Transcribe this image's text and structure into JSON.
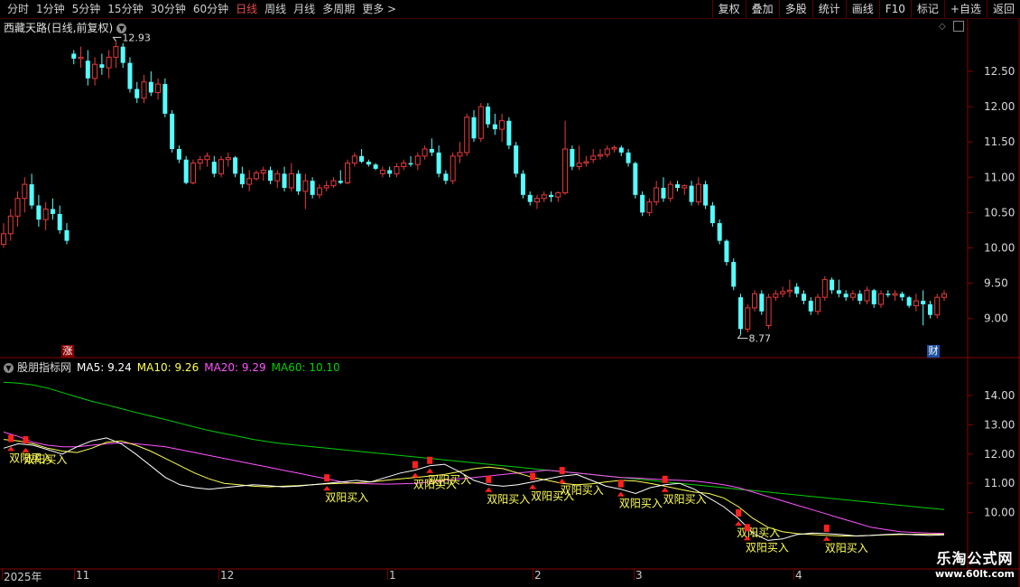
{
  "toolbar": {
    "periods": [
      "分时",
      "1分钟",
      "5分钟",
      "15分钟",
      "30分钟",
      "60分钟",
      "日线",
      "周线",
      "月线",
      "多周期",
      "更多 >"
    ],
    "active_period": "日线",
    "buttons": [
      "复权",
      "叠加",
      "多股",
      "统计",
      "画线",
      "F10",
      "标记",
      "+自选",
      "返回"
    ]
  },
  "main_chart": {
    "title": "西藏天路(日线,前复权)",
    "y_ticks": [
      "12.50",
      "12.00",
      "11.50",
      "11.00",
      "10.50",
      "10.00",
      "9.50",
      "9.00"
    ],
    "high_label": "12.93",
    "low_label": "8.77",
    "badge_zhang": "涨",
    "badge_cai": "财"
  },
  "indicator": {
    "name": "股朋指标网",
    "ma5": "MA5: 9.24",
    "ma10": "MA10: 9.26",
    "ma20": "MA20: 9.29",
    "ma60": "MA60: 10.10",
    "y_ticks": [
      "14.00",
      "13.00",
      "12.00",
      "11.00",
      "10.00"
    ],
    "signal_text": "双阳买入"
  },
  "x_axis": {
    "labels": [
      "2025年",
      "11",
      "12",
      "1",
      "2",
      "3",
      "4"
    ]
  },
  "colors": {
    "up": "#e83a3a",
    "down": "#54ffff",
    "ma5": "#ffffff",
    "ma10": "#ffff54",
    "ma20": "#ff54ff",
    "ma60": "#00d000",
    "grid": "#8a0000"
  },
  "watermark": {
    "line1": "乐淘公式网",
    "line2": "www.60lt.com"
  },
  "chart_data": {
    "type": "candlestick",
    "title": "西藏天路(日线,前复权)",
    "candles": [
      {
        "o": 10.05,
        "h": 10.35,
        "l": 10.0,
        "c": 10.2
      },
      {
        "o": 10.2,
        "h": 10.55,
        "l": 10.1,
        "c": 10.45
      },
      {
        "o": 10.45,
        "h": 10.8,
        "l": 10.3,
        "c": 10.7
      },
      {
        "o": 10.7,
        "h": 11.0,
        "l": 10.5,
        "c": 10.9
      },
      {
        "o": 10.9,
        "h": 11.05,
        "l": 10.55,
        "c": 10.6
      },
      {
        "o": 10.6,
        "h": 10.75,
        "l": 10.3,
        "c": 10.4
      },
      {
        "o": 10.4,
        "h": 10.65,
        "l": 10.25,
        "c": 10.55
      },
      {
        "o": 10.55,
        "h": 10.7,
        "l": 10.4,
        "c": 10.48
      },
      {
        "o": 10.48,
        "h": 10.6,
        "l": 10.2,
        "c": 10.25
      },
      {
        "o": 10.25,
        "h": 10.35,
        "l": 10.05,
        "c": 10.1
      },
      {
        "o": 12.75,
        "h": 12.8,
        "l": 12.6,
        "c": 12.68
      },
      {
        "o": 12.68,
        "h": 12.85,
        "l": 12.55,
        "c": 12.7
      },
      {
        "o": 12.65,
        "h": 12.8,
        "l": 12.3,
        "c": 12.4
      },
      {
        "o": 12.4,
        "h": 12.7,
        "l": 12.3,
        "c": 12.6
      },
      {
        "o": 12.6,
        "h": 12.75,
        "l": 12.45,
        "c": 12.55
      },
      {
        "o": 12.55,
        "h": 12.8,
        "l": 12.4,
        "c": 12.7
      },
      {
        "o": 12.7,
        "h": 12.93,
        "l": 12.55,
        "c": 12.85
      },
      {
        "o": 12.85,
        "h": 12.9,
        "l": 12.55,
        "c": 12.62
      },
      {
        "o": 12.62,
        "h": 12.7,
        "l": 12.2,
        "c": 12.25
      },
      {
        "o": 12.25,
        "h": 12.35,
        "l": 12.05,
        "c": 12.12
      },
      {
        "o": 12.12,
        "h": 12.45,
        "l": 12.05,
        "c": 12.35
      },
      {
        "o": 12.35,
        "h": 12.5,
        "l": 12.15,
        "c": 12.2
      },
      {
        "o": 12.2,
        "h": 12.4,
        "l": 12.1,
        "c": 12.32
      },
      {
        "o": 12.32,
        "h": 12.4,
        "l": 11.85,
        "c": 11.9
      },
      {
        "o": 11.9,
        "h": 11.95,
        "l": 11.35,
        "c": 11.4
      },
      {
        "o": 11.4,
        "h": 11.45,
        "l": 11.2,
        "c": 11.25
      },
      {
        "o": 11.25,
        "h": 11.3,
        "l": 10.9,
        "c": 10.92
      },
      {
        "o": 10.92,
        "h": 11.25,
        "l": 10.9,
        "c": 11.2
      },
      {
        "o": 11.2,
        "h": 11.3,
        "l": 11.1,
        "c": 11.25
      },
      {
        "o": 11.25,
        "h": 11.35,
        "l": 11.15,
        "c": 11.3
      },
      {
        "o": 11.22,
        "h": 11.3,
        "l": 11.0,
        "c": 11.05
      },
      {
        "o": 11.05,
        "h": 11.3,
        "l": 11.0,
        "c": 11.25
      },
      {
        "o": 11.25,
        "h": 11.35,
        "l": 11.15,
        "c": 11.28
      },
      {
        "o": 11.28,
        "h": 11.3,
        "l": 11.0,
        "c": 11.05
      },
      {
        "o": 11.05,
        "h": 11.15,
        "l": 10.85,
        "c": 10.9
      },
      {
        "o": 10.9,
        "h": 11.1,
        "l": 10.8,
        "c": 10.98
      },
      {
        "o": 10.98,
        "h": 11.1,
        "l": 10.95,
        "c": 11.06
      },
      {
        "o": 11.06,
        "h": 11.15,
        "l": 10.95,
        "c": 11.1
      },
      {
        "o": 11.1,
        "h": 11.15,
        "l": 10.9,
        "c": 10.95
      },
      {
        "o": 10.95,
        "h": 11.1,
        "l": 10.85,
        "c": 11.05
      },
      {
        "o": 11.05,
        "h": 11.15,
        "l": 10.8,
        "c": 10.85
      },
      {
        "o": 10.85,
        "h": 11.2,
        "l": 10.8,
        "c": 11.05
      },
      {
        "o": 11.05,
        "h": 11.1,
        "l": 10.75,
        "c": 10.8
      },
      {
        "o": 10.8,
        "h": 11.05,
        "l": 10.55,
        "c": 10.95
      },
      {
        "o": 10.95,
        "h": 11.0,
        "l": 10.7,
        "c": 10.75
      },
      {
        "o": 10.75,
        "h": 10.9,
        "l": 10.7,
        "c": 10.85
      },
      {
        "o": 10.85,
        "h": 10.95,
        "l": 10.8,
        "c": 10.88
      },
      {
        "o": 10.88,
        "h": 11.0,
        "l": 10.85,
        "c": 10.95
      },
      {
        "o": 10.95,
        "h": 11.1,
        "l": 10.9,
        "c": 10.92
      },
      {
        "o": 10.92,
        "h": 11.25,
        "l": 10.9,
        "c": 11.2
      },
      {
        "o": 11.2,
        "h": 11.35,
        "l": 11.15,
        "c": 11.3
      },
      {
        "o": 11.3,
        "h": 11.4,
        "l": 11.2,
        "c": 11.22
      },
      {
        "o": 11.22,
        "h": 11.25,
        "l": 11.15,
        "c": 11.18
      },
      {
        "o": 11.18,
        "h": 11.2,
        "l": 11.1,
        "c": 11.12
      },
      {
        "o": 11.05,
        "h": 11.15,
        "l": 11.0,
        "c": 11.1
      },
      {
        "o": 11.1,
        "h": 11.15,
        "l": 11.0,
        "c": 11.05
      },
      {
        "o": 11.05,
        "h": 11.2,
        "l": 11.0,
        "c": 11.15
      },
      {
        "o": 11.15,
        "h": 11.25,
        "l": 11.1,
        "c": 11.2
      },
      {
        "o": 11.2,
        "h": 11.3,
        "l": 11.15,
        "c": 11.18
      },
      {
        "o": 11.18,
        "h": 11.35,
        "l": 11.1,
        "c": 11.3
      },
      {
        "o": 11.3,
        "h": 11.45,
        "l": 11.25,
        "c": 11.4
      },
      {
        "o": 11.4,
        "h": 11.55,
        "l": 11.3,
        "c": 11.35
      },
      {
        "o": 11.35,
        "h": 11.45,
        "l": 11.0,
        "c": 11.05
      },
      {
        "o": 11.05,
        "h": 11.1,
        "l": 10.9,
        "c": 10.95
      },
      {
        "o": 10.95,
        "h": 11.35,
        "l": 10.9,
        "c": 11.3
      },
      {
        "o": 11.3,
        "h": 11.5,
        "l": 11.2,
        "c": 11.35
      },
      {
        "o": 11.35,
        "h": 11.9,
        "l": 11.3,
        "c": 11.85
      },
      {
        "o": 11.85,
        "h": 11.95,
        "l": 11.5,
        "c": 11.55
      },
      {
        "o": 11.55,
        "h": 12.05,
        "l": 11.5,
        "c": 12.0
      },
      {
        "o": 12.0,
        "h": 12.05,
        "l": 11.7,
        "c": 11.75
      },
      {
        "o": 11.75,
        "h": 11.9,
        "l": 11.6,
        "c": 11.68
      },
      {
        "o": 11.68,
        "h": 11.9,
        "l": 11.5,
        "c": 11.8
      },
      {
        "o": 11.8,
        "h": 11.85,
        "l": 11.4,
        "c": 11.45
      },
      {
        "o": 11.45,
        "h": 11.5,
        "l": 11.0,
        "c": 11.05
      },
      {
        "o": 11.05,
        "h": 11.1,
        "l": 10.7,
        "c": 10.75
      },
      {
        "o": 10.75,
        "h": 10.8,
        "l": 10.6,
        "c": 10.65
      },
      {
        "o": 10.65,
        "h": 10.75,
        "l": 10.55,
        "c": 10.7
      },
      {
        "o": 10.7,
        "h": 10.8,
        "l": 10.65,
        "c": 10.75
      },
      {
        "o": 10.75,
        "h": 10.8,
        "l": 10.65,
        "c": 10.72
      },
      {
        "o": 10.72,
        "h": 10.8,
        "l": 10.65,
        "c": 10.78
      },
      {
        "o": 10.78,
        "h": 11.8,
        "l": 10.75,
        "c": 11.4
      },
      {
        "o": 11.4,
        "h": 11.45,
        "l": 11.1,
        "c": 11.15
      },
      {
        "o": 11.15,
        "h": 11.45,
        "l": 11.1,
        "c": 11.2
      },
      {
        "o": 11.2,
        "h": 11.3,
        "l": 11.15,
        "c": 11.22
      },
      {
        "o": 11.25,
        "h": 11.4,
        "l": 11.2,
        "c": 11.3
      },
      {
        "o": 11.3,
        "h": 11.4,
        "l": 11.25,
        "c": 11.32
      },
      {
        "o": 11.32,
        "h": 11.45,
        "l": 11.28,
        "c": 11.4
      },
      {
        "o": 11.4,
        "h": 11.45,
        "l": 11.35,
        "c": 11.42
      },
      {
        "o": 11.42,
        "h": 11.45,
        "l": 11.3,
        "c": 11.35
      },
      {
        "o": 11.35,
        "h": 11.4,
        "l": 11.15,
        "c": 11.2
      },
      {
        "o": 11.2,
        "h": 11.22,
        "l": 10.7,
        "c": 10.75
      },
      {
        "o": 10.75,
        "h": 10.8,
        "l": 10.45,
        "c": 10.5
      },
      {
        "o": 10.5,
        "h": 10.7,
        "l": 10.45,
        "c": 10.65
      },
      {
        "o": 10.65,
        "h": 10.95,
        "l": 10.6,
        "c": 10.85
      },
      {
        "o": 10.85,
        "h": 11.0,
        "l": 10.65,
        "c": 10.7
      },
      {
        "o": 10.7,
        "h": 10.95,
        "l": 10.65,
        "c": 10.9
      },
      {
        "o": 10.9,
        "h": 10.95,
        "l": 10.8,
        "c": 10.85
      },
      {
        "o": 10.85,
        "h": 10.9,
        "l": 10.75,
        "c": 10.88
      },
      {
        "o": 10.88,
        "h": 10.95,
        "l": 10.6,
        "c": 10.65
      },
      {
        "o": 10.65,
        "h": 11.0,
        "l": 10.6,
        "c": 10.9
      },
      {
        "o": 10.9,
        "h": 10.95,
        "l": 10.55,
        "c": 10.6
      },
      {
        "o": 10.6,
        "h": 10.65,
        "l": 10.3,
        "c": 10.35
      },
      {
        "o": 10.35,
        "h": 10.4,
        "l": 10.05,
        "c": 10.1
      },
      {
        "o": 10.1,
        "h": 10.12,
        "l": 9.75,
        "c": 9.8
      },
      {
        "o": 9.8,
        "h": 9.85,
        "l": 9.4,
        "c": 9.45
      },
      {
        "o": 9.3,
        "h": 9.35,
        "l": 8.77,
        "c": 8.85
      },
      {
        "o": 8.85,
        "h": 9.2,
        "l": 8.8,
        "c": 9.15
      },
      {
        "o": 9.15,
        "h": 9.4,
        "l": 9.1,
        "c": 9.35
      },
      {
        "o": 9.35,
        "h": 9.4,
        "l": 9.05,
        "c": 9.1
      },
      {
        "o": 8.9,
        "h": 9.35,
        "l": 8.85,
        "c": 9.3
      },
      {
        "o": 9.3,
        "h": 9.4,
        "l": 9.25,
        "c": 9.35
      },
      {
        "o": 9.35,
        "h": 9.45,
        "l": 9.3,
        "c": 9.38
      },
      {
        "o": 9.38,
        "h": 9.55,
        "l": 9.3,
        "c": 9.4
      },
      {
        "o": 9.45,
        "h": 9.5,
        "l": 9.3,
        "c": 9.35
      },
      {
        "o": 9.35,
        "h": 9.4,
        "l": 9.2,
        "c": 9.25
      },
      {
        "o": 9.25,
        "h": 9.3,
        "l": 9.05,
        "c": 9.1
      },
      {
        "o": 9.1,
        "h": 9.35,
        "l": 9.05,
        "c": 9.3
      },
      {
        "o": 9.3,
        "h": 9.6,
        "l": 9.25,
        "c": 9.55
      },
      {
        "o": 9.55,
        "h": 9.58,
        "l": 9.35,
        "c": 9.4
      },
      {
        "o": 9.4,
        "h": 9.55,
        "l": 9.3,
        "c": 9.35
      },
      {
        "o": 9.35,
        "h": 9.4,
        "l": 9.25,
        "c": 9.3
      },
      {
        "o": 9.3,
        "h": 9.4,
        "l": 9.25,
        "c": 9.35
      },
      {
        "o": 9.35,
        "h": 9.4,
        "l": 9.2,
        "c": 9.25
      },
      {
        "o": 9.25,
        "h": 9.45,
        "l": 9.2,
        "c": 9.4
      },
      {
        "o": 9.4,
        "h": 9.42,
        "l": 9.15,
        "c": 9.2
      },
      {
        "o": 9.2,
        "h": 9.4,
        "l": 9.15,
        "c": 9.35
      },
      {
        "o": 9.35,
        "h": 9.4,
        "l": 9.3,
        "c": 9.33
      },
      {
        "o": 9.33,
        "h": 9.4,
        "l": 9.25,
        "c": 9.35
      },
      {
        "o": 9.35,
        "h": 9.38,
        "l": 9.25,
        "c": 9.3
      },
      {
        "o": 9.3,
        "h": 9.32,
        "l": 9.15,
        "c": 9.18
      },
      {
        "o": 9.18,
        "h": 9.35,
        "l": 9.1,
        "c": 9.25
      },
      {
        "o": 9.25,
        "h": 9.4,
        "l": 8.9,
        "c": 9.2
      },
      {
        "o": 9.2,
        "h": 9.25,
        "l": 9.0,
        "c": 9.05
      },
      {
        "o": 9.05,
        "h": 9.35,
        "l": 9.0,
        "c": 9.3
      },
      {
        "o": 9.3,
        "h": 9.4,
        "l": 9.25,
        "c": 9.35
      }
    ],
    "y_range": [
      8.65,
      13.05
    ],
    "indicator": {
      "y_range": [
        9.0,
        14.8
      ],
      "ma60": [
        14.45,
        14.42,
        14.36,
        14.25,
        14.1,
        13.95,
        13.8,
        13.68,
        13.55,
        13.42,
        13.3,
        13.18,
        13.05,
        12.92,
        12.8,
        12.7,
        12.6,
        12.5,
        12.42,
        12.35,
        12.3,
        12.25,
        12.2,
        12.15,
        12.1,
        12.05,
        12.0,
        11.95,
        11.9,
        11.85,
        11.8,
        11.75,
        11.7,
        11.65,
        11.6,
        11.55,
        11.5,
        11.45,
        11.4,
        11.35,
        11.3,
        11.25,
        11.2,
        11.15,
        11.1,
        11.05,
        11.0,
        10.95,
        10.9,
        10.85,
        10.8,
        10.75,
        10.7,
        10.65,
        10.6,
        10.55,
        10.5,
        10.45,
        10.4,
        10.35,
        10.3,
        10.25,
        10.2,
        10.15,
        10.1
      ],
      "ma20": [
        12.75,
        12.6,
        12.4,
        12.3,
        12.25,
        12.25,
        12.3,
        12.35,
        12.38,
        12.35,
        12.3,
        12.25,
        12.15,
        12.05,
        11.95,
        11.85,
        11.75,
        11.65,
        11.55,
        11.45,
        11.35,
        11.25,
        11.15,
        11.05,
        11.0,
        10.98,
        10.97,
        10.98,
        11.0,
        11.05,
        11.1,
        11.15,
        11.2,
        11.25,
        11.3,
        11.35,
        11.4,
        11.45,
        11.4,
        11.35,
        11.3,
        11.25,
        11.2,
        11.18,
        11.15,
        11.12,
        11.1,
        11.08,
        11.02,
        10.95,
        10.85,
        10.7,
        10.55,
        10.4,
        10.25,
        10.1,
        9.95,
        9.8,
        9.65,
        9.5,
        9.42,
        9.35,
        9.32,
        9.3,
        9.29
      ],
      "ma10": [
        12.5,
        12.45,
        12.35,
        12.2,
        12.1,
        12.05,
        12.2,
        12.4,
        12.45,
        12.3,
        12.1,
        11.85,
        11.6,
        11.35,
        11.15,
        11.0,
        10.95,
        10.9,
        10.88,
        10.9,
        10.92,
        10.95,
        10.98,
        11.0,
        11.02,
        11.05,
        11.1,
        11.15,
        11.2,
        11.25,
        11.3,
        11.4,
        11.5,
        11.55,
        11.5,
        11.35,
        11.2,
        11.1,
        11.0,
        10.95,
        10.98,
        11.05,
        11.1,
        11.08,
        11.0,
        10.9,
        10.8,
        10.7,
        10.65,
        10.5,
        10.2,
        9.8,
        9.5,
        9.35,
        9.28,
        9.25,
        9.22,
        9.2,
        9.2,
        9.22,
        9.24,
        9.25,
        9.26,
        9.26,
        9.26
      ],
      "ma5": [
        12.2,
        12.35,
        12.3,
        12.15,
        12.0,
        12.25,
        12.45,
        12.55,
        12.35,
        12.0,
        11.6,
        11.2,
        10.95,
        10.85,
        10.8,
        10.85,
        10.9,
        10.95,
        10.92,
        10.88,
        10.9,
        10.95,
        11.0,
        11.05,
        11.1,
        11.05,
        11.2,
        11.35,
        11.45,
        11.6,
        11.65,
        11.4,
        11.1,
        10.95,
        10.9,
        10.95,
        11.05,
        11.15,
        11.25,
        11.3,
        11.1,
        10.9,
        10.8,
        10.65,
        10.85,
        10.95,
        11.0,
        10.8,
        10.5,
        10.2,
        9.8,
        9.3,
        9.05,
        9.1,
        9.25,
        9.3,
        9.28,
        9.25,
        9.2,
        9.22,
        9.25,
        9.27,
        9.24,
        9.22,
        9.24
      ]
    },
    "signals": [
      0.5,
      1.5,
      22,
      28,
      29,
      33,
      36,
      38,
      42,
      45,
      50,
      50.6,
      56,
      85,
      88
    ]
  }
}
